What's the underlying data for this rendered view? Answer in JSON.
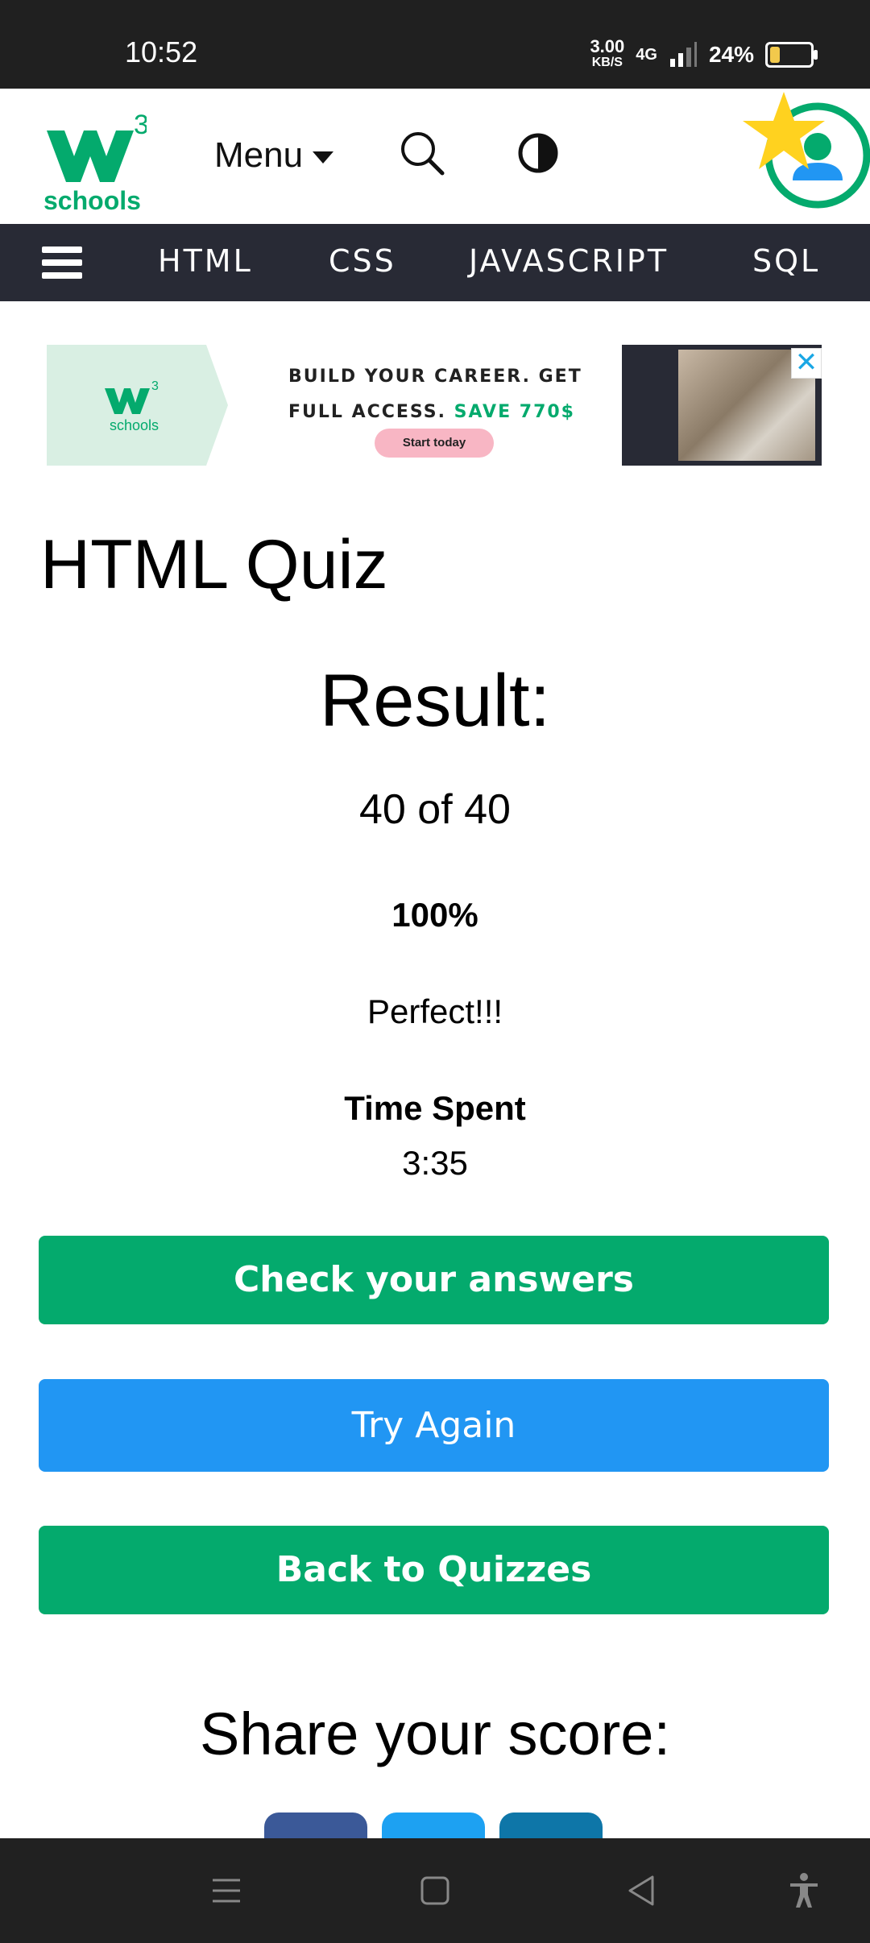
{
  "status_bar": {
    "time": "10:52",
    "speed_value": "3.00",
    "speed_unit": "KB/S",
    "network": "4G",
    "battery_percent": "24%",
    "battery_level": 0.24
  },
  "header": {
    "logo_superscript": "3",
    "logo_text": "schools",
    "menu_label": "Menu",
    "icons": [
      "search-icon",
      "contrast-icon",
      "user-avatar-icon",
      "star-icon"
    ]
  },
  "subnav": {
    "items": [
      "HTML",
      "CSS",
      "JAVASCRIPT",
      "SQL"
    ]
  },
  "ad": {
    "line1": "BUILD YOUR CAREER. GET",
    "line2_prefix": "FULL ACCESS.",
    "line2_highlight": "SAVE 770$",
    "cta": "Start today",
    "logo_text": "schools",
    "close_glyph": "✕"
  },
  "page": {
    "title": "HTML Quiz"
  },
  "result": {
    "heading": "Result:",
    "score": "40 of 40",
    "percent": "100%",
    "grade": "Perfect!!!",
    "time_label": "Time Spent",
    "time_value": "3:35"
  },
  "buttons": {
    "check": "Check your answers",
    "try_again": "Try Again",
    "back": "Back to Quizzes"
  },
  "share": {
    "heading": "Share your score:",
    "buttons": [
      "facebook",
      "twitter",
      "linkedin"
    ]
  },
  "colors": {
    "brand_green": "#04aa6d",
    "blue": "#2196f3",
    "dark_nav": "#282a35",
    "star": "#ffd21f",
    "facebook": "#3b5998",
    "twitter": "#1da1f2",
    "linkedin": "#0e76a8"
  }
}
